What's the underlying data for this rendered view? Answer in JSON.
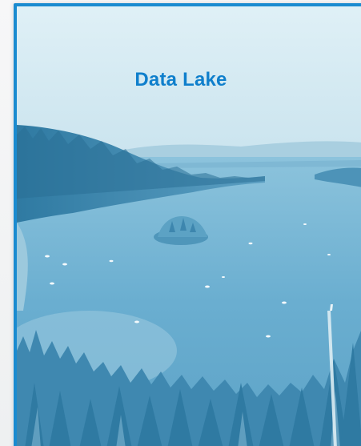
{
  "title": "Data Lake",
  "colors": {
    "border": "#1a8bd0",
    "title": "#0f7fcc",
    "sky": "#d6ebf3",
    "water": "#6aaed0",
    "forest": "#3f8bb0"
  },
  "image": {
    "subject": "lake-landscape"
  }
}
